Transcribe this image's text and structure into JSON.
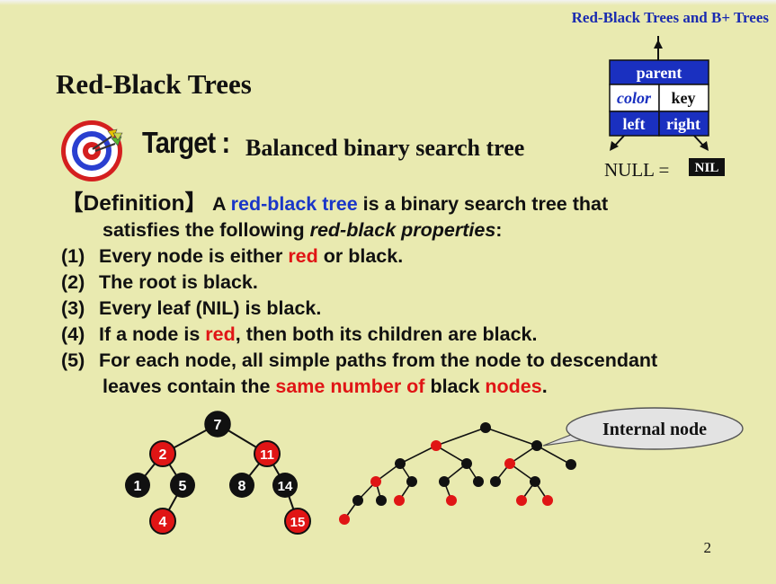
{
  "header": {
    "course_title": "Red-Black Trees and B+ Trees"
  },
  "slide": {
    "title": "Red-Black Trees",
    "target_label": "Target :",
    "target_text": "Balanced binary search tree",
    "page_number": "2"
  },
  "node_structure": {
    "parent": "parent",
    "color": "color",
    "key": "key",
    "left": "left",
    "right": "right",
    "null_label": "NULL =",
    "nil_label": "NIL"
  },
  "definition": {
    "label": "【Definition】",
    "line1_a": "A",
    "line1_b": "red-black tree",
    "line1_c": "is a binary search tree that",
    "line2_a": "satisfies the following",
    "line2_b": "red-black properties",
    "line2_c": ":",
    "properties": [
      {
        "num": "(1)",
        "parts": [
          "Every node is either ",
          "red",
          " or ",
          "black",
          "."
        ]
      },
      {
        "num": "(2)",
        "parts": [
          "The root is ",
          "black",
          "."
        ]
      },
      {
        "num": "(3)",
        "parts": [
          "Every leaf (NIL) is ",
          "black",
          "."
        ]
      },
      {
        "num": "(4)",
        "parts": [
          "If a node is ",
          "red",
          ", then both its children are ",
          "black",
          "."
        ]
      },
      {
        "num": "(5)",
        "parts": [
          "For each node, all simple paths from the node to descendant"
        ]
      }
    ],
    "prop5_cont": {
      "a": "leaves contain the ",
      "b": "same number of",
      "c": " ",
      "d": "black",
      "e": " nodes",
      "f": "."
    }
  },
  "example_tree": {
    "nodes": [
      {
        "key": "7",
        "color": "black"
      },
      {
        "key": "2",
        "color": "red"
      },
      {
        "key": "11",
        "color": "red"
      },
      {
        "key": "1",
        "color": "black"
      },
      {
        "key": "5",
        "color": "black"
      },
      {
        "key": "8",
        "color": "black"
      },
      {
        "key": "14",
        "color": "black"
      },
      {
        "key": "4",
        "color": "red"
      },
      {
        "key": "15",
        "color": "red"
      }
    ]
  },
  "callout": {
    "text": "Internal node"
  },
  "colors": {
    "red_node": "#e01515",
    "black_node": "#111111",
    "title_blue": "#1a2bb0",
    "struct_blue": "#1a30c0",
    "background": "#e9eab0"
  }
}
